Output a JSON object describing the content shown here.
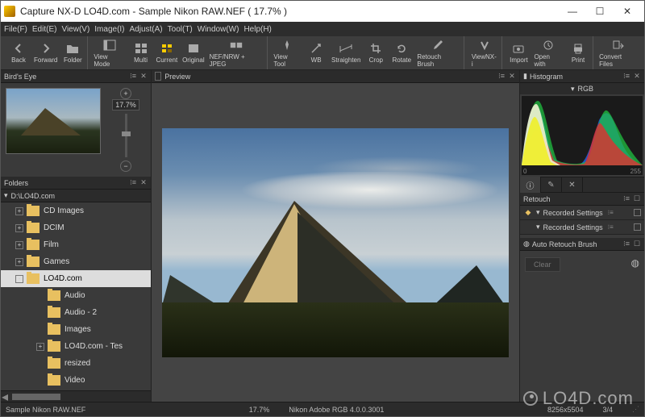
{
  "window": {
    "app_name": "Capture NX-D",
    "title_sep": "    ",
    "document": "LO4D.com - Sample Nikon RAW.NEF ( 17.7% )"
  },
  "menu": {
    "items": [
      "File(F)",
      "Edit(E)",
      "View(V)",
      "Image(I)",
      "Adjust(A)",
      "Tool(T)",
      "Window(W)",
      "Help(H)"
    ]
  },
  "toolbar": {
    "back": "Back",
    "forward": "Forward",
    "folder": "Folder",
    "view_mode": "View Mode",
    "multi": "Multi",
    "current": "Current",
    "original": "Original",
    "nef": "NEF/NRW + JPEG",
    "view_tool": "View Tool",
    "wb": "WB",
    "straighten": "Straighten",
    "crop": "Crop",
    "rotate": "Rotate",
    "retouch_brush": "Retouch Brush",
    "viewnx": "ViewNX-i",
    "import": "Import",
    "open_with": "Open with",
    "print": "Print",
    "convert": "Convert Files"
  },
  "birdseye": {
    "title": "Bird's Eye",
    "zoom_value": "17.7%"
  },
  "folders": {
    "title": "Folders",
    "path": "D:\\LO4D.com",
    "tree": [
      {
        "label": "CD Images",
        "depth": 1,
        "exp": "+"
      },
      {
        "label": "DCIM",
        "depth": 1,
        "exp": "+"
      },
      {
        "label": "Film",
        "depth": 1,
        "exp": "+"
      },
      {
        "label": "Games",
        "depth": 1,
        "exp": "+"
      },
      {
        "label": "LO4D.com",
        "depth": 1,
        "exp": "-",
        "sel": true
      },
      {
        "label": "Audio",
        "depth": 2,
        "exp": ""
      },
      {
        "label": "Audio - 2",
        "depth": 2,
        "exp": ""
      },
      {
        "label": "Images",
        "depth": 2,
        "exp": ""
      },
      {
        "label": "LO4D.com - Tes",
        "depth": 2,
        "exp": "+"
      },
      {
        "label": "resized",
        "depth": 2,
        "exp": ""
      },
      {
        "label": "Video",
        "depth": 2,
        "exp": ""
      }
    ]
  },
  "preview": {
    "title": "Preview"
  },
  "histogram": {
    "title": "Histogram",
    "mode": "RGB",
    "min": "0",
    "max": "255"
  },
  "retouch": {
    "title": "Retouch",
    "rows": [
      {
        "label": "Recorded Settings"
      },
      {
        "label": "Recorded Settings"
      }
    ],
    "auto_title": "Auto Retouch Brush",
    "clear": "Clear"
  },
  "status": {
    "filename": "Sample Nikon RAW.NEF",
    "zoom": "17.7%",
    "profile": "Nikon Adobe RGB 4.0.0.3001",
    "dimensions": "8256x5504",
    "index": "3/4"
  },
  "watermark": "LO4D.com"
}
